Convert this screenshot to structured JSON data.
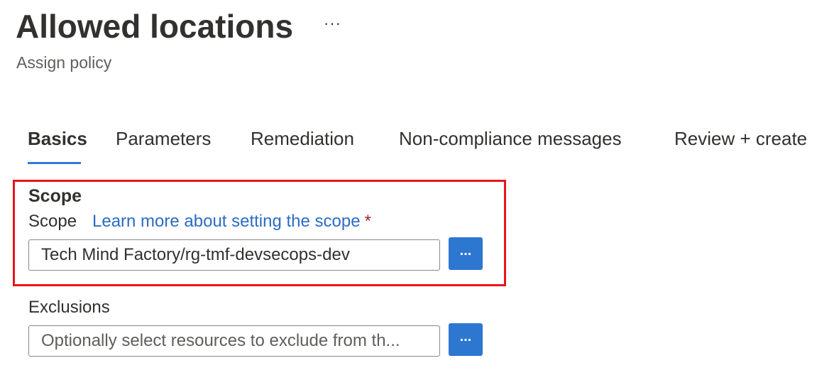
{
  "header": {
    "title": "Allowed locations",
    "more_label": "···",
    "subtitle": "Assign policy"
  },
  "tabs": [
    {
      "label": "Basics",
      "active": true
    },
    {
      "label": "Parameters",
      "active": false
    },
    {
      "label": "Remediation",
      "active": false
    },
    {
      "label": "Non-compliance messages",
      "active": false
    },
    {
      "label": "Review + create",
      "active": false
    }
  ],
  "scope_section": {
    "heading": "Scope",
    "field_label": "Scope",
    "learn_more_link": "Learn more about setting the scope",
    "required_marker": "*",
    "value": "Tech Mind Factory/rg-tmf-devsecops-dev",
    "browse_label": "..."
  },
  "exclusions": {
    "field_label": "Exclusions",
    "placeholder": "Optionally select resources to exclude from th...",
    "browse_label": "..."
  },
  "colors": {
    "accent": "#2e77d0",
    "link": "#2b6cc4",
    "highlight_border": "#e8151b",
    "required": "#a4262c"
  }
}
